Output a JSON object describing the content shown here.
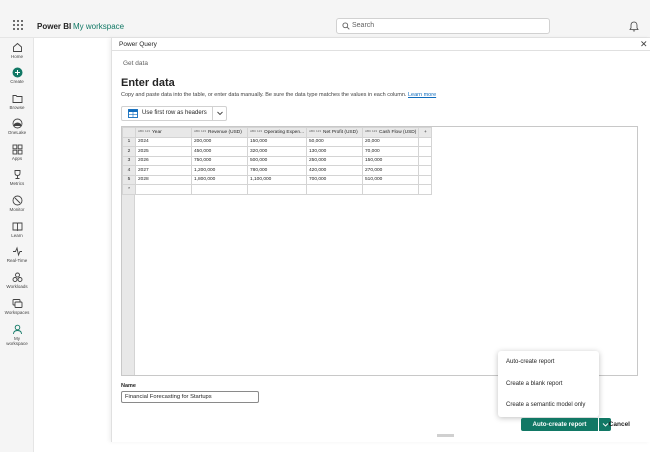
{
  "app": {
    "brand": "Power BI",
    "workspace_link": "My workspace"
  },
  "search": {
    "placeholder": "Search"
  },
  "nav": {
    "home": "Home",
    "create": "Create",
    "browse": "Browse",
    "onelake": "OneLake",
    "apps": "Apps",
    "metrics": "Metrics",
    "monitor": "Monitor",
    "learn": "Learn",
    "realtime": "Real-Time",
    "workloads": "Workloads",
    "workspaces": "Workspaces",
    "my_workspace_1": "My",
    "my_workspace_2": "workspace"
  },
  "dialog": {
    "title": "Power Query",
    "breadcrumb": "Get data",
    "heading": "Enter data",
    "instructions": "Copy and paste data into the table, or enter data manually. Be sure the data type matches the values in each column.",
    "learn_more": "Learn more",
    "use_first_row": "Use first row as headers",
    "name_label": "Name",
    "name_value": "Financial Forecasting for Startups"
  },
  "table": {
    "type_badge": "ABC 123",
    "add_column": "+",
    "columns": [
      "Year",
      "Revenue (USD)",
      "Operating Expen...",
      "Net Profit (USD)",
      "Cash Flow (USD)"
    ],
    "rows": [
      {
        "n": "1",
        "cells": [
          "2024",
          "200,000",
          "150,000",
          "50,000",
          "20,000"
        ]
      },
      {
        "n": "2",
        "cells": [
          "2025",
          "450,000",
          "320,000",
          "130,000",
          "70,000"
        ]
      },
      {
        "n": "3",
        "cells": [
          "2026",
          "750,000",
          "500,000",
          "250,000",
          "150,000"
        ]
      },
      {
        "n": "4",
        "cells": [
          "2027",
          "1,200,000",
          "780,000",
          "420,000",
          "270,000"
        ]
      },
      {
        "n": "5",
        "cells": [
          "2028",
          "1,800,000",
          "1,100,000",
          "700,000",
          "510,000"
        ]
      }
    ],
    "new_row_marker": "*"
  },
  "menu": {
    "items": [
      "Auto-create report",
      "Create a blank report",
      "Create a semantic model only"
    ]
  },
  "footer": {
    "primary_button": "Auto-create report",
    "cancel_button": "Cancel"
  },
  "colors": {
    "accent": "#117865",
    "link": "#0f6cbd"
  },
  "icons": [
    "waffle-icon",
    "search-icon",
    "bell-icon",
    "home-icon",
    "create-icon",
    "browse-icon",
    "onelake-icon",
    "apps-icon",
    "metrics-icon",
    "monitor-icon",
    "learn-icon",
    "realtime-icon",
    "workloads-icon",
    "workspaces-icon",
    "person-icon",
    "table-icon",
    "chevron-down-icon",
    "close-icon"
  ]
}
